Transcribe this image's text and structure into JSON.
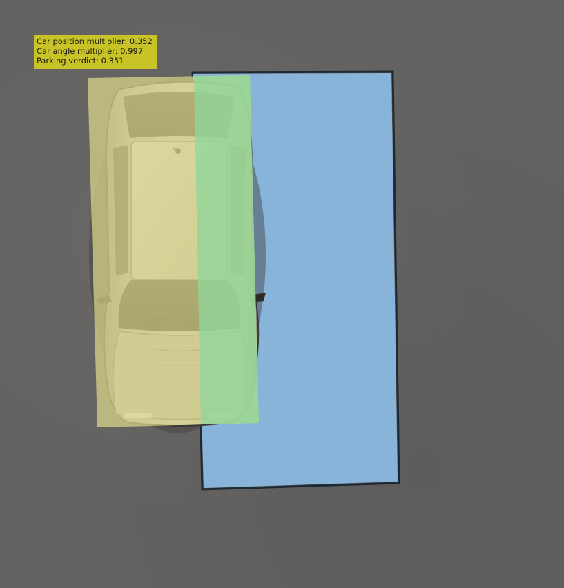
{
  "overlay": {
    "position_label": "Car position multiplier:",
    "position_value": "0.352",
    "angle_label": "Car angle multiplier:",
    "angle_value": "0.997",
    "verdict_label": "Parking verdict:",
    "verdict_value": "0.351"
  },
  "colors": {
    "ground": "#646260",
    "parking_zone": "#8ab8e0",
    "car_zone": "#dcd88a",
    "overlap_zone": "#8fd69a",
    "info_panel": "#c8c326"
  },
  "metrics": {
    "car_position_multiplier": 0.352,
    "car_angle_multiplier": 0.997,
    "parking_verdict": 0.351
  }
}
